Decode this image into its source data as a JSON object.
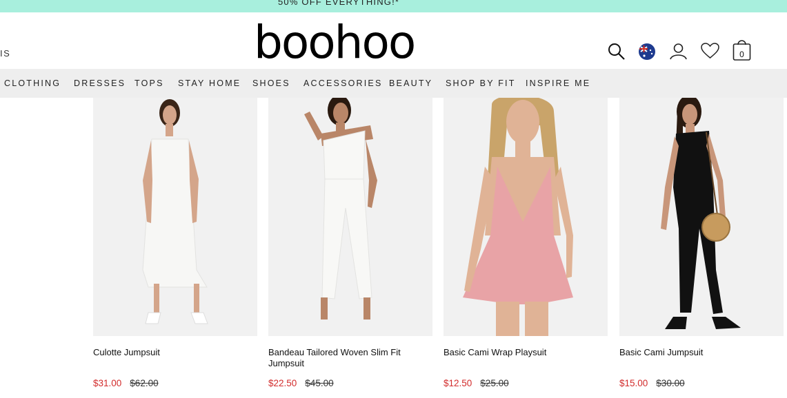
{
  "promo": {
    "text": "50% OFF EVERYTHING!*"
  },
  "header": {
    "brand": "boohoo",
    "left_fragment": "IS",
    "icons": [
      "search-icon",
      "flag-icon",
      "account-icon",
      "wishlist-icon",
      "bag-icon"
    ],
    "bag_count": "0"
  },
  "nav": {
    "items": [
      "CLOTHING",
      "DRESSES",
      "TOPS",
      "STAY HOME",
      "SHOES",
      "ACCESSORIES",
      "BEAUTY",
      "SHOP BY FIT",
      "INSPIRE ME"
    ]
  },
  "products": [
    {
      "name": "Culotte Jumpsuit",
      "price": "$31.00",
      "was": "$62.00",
      "color": "#f7f7f5"
    },
    {
      "name": "Bandeau Tailored Woven Slim Fit Jumpsuit",
      "price": "$22.50",
      "was": "$45.00",
      "color": "#f8f8f6"
    },
    {
      "name": "Basic Cami Wrap Playsuit",
      "price": "$12.50",
      "was": "$25.00",
      "color": "#e8a3a6"
    },
    {
      "name": "Basic Cami Jumpsuit",
      "price": "$15.00",
      "was": "$30.00",
      "color": "#111111"
    }
  ],
  "colors": {
    "promo_bg": "#a8efdd",
    "nav_bg": "#eeeeee",
    "sale_price": "#d22b2b"
  }
}
